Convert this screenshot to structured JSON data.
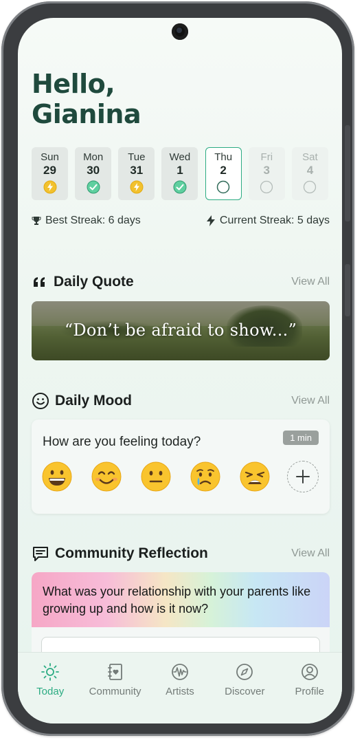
{
  "greeting": {
    "line1": "Hello,",
    "line2": "Gianina"
  },
  "week": [
    {
      "name": "Sun",
      "date": "29",
      "status": "lightning",
      "state": "past"
    },
    {
      "name": "Mon",
      "date": "30",
      "status": "check",
      "state": "past"
    },
    {
      "name": "Tue",
      "date": "31",
      "status": "lightning",
      "state": "past"
    },
    {
      "name": "Wed",
      "date": "1",
      "status": "check",
      "state": "past"
    },
    {
      "name": "Thu",
      "date": "2",
      "status": "empty",
      "state": "today"
    },
    {
      "name": "Fri",
      "date": "3",
      "status": "empty",
      "state": "future"
    },
    {
      "name": "Sat",
      "date": "4",
      "status": "empty",
      "state": "future"
    }
  ],
  "streaks": {
    "best": "Best Streak: 6 days",
    "current": "Current Streak: 5 days"
  },
  "daily_quote": {
    "title": "Daily Quote",
    "view_all": "View All",
    "text": "“Don’t be afraid to show...”"
  },
  "daily_mood": {
    "title": "Daily Mood",
    "view_all": "View All",
    "question": "How are you feeling today?",
    "time_badge": "1 min",
    "emojis": [
      "grinning-face",
      "smiling-face",
      "neutral-face",
      "crying-face",
      "weary-face"
    ]
  },
  "community": {
    "title": "Community Reflection",
    "view_all": "View All",
    "question": "What was your relationship with your parents like growing up and how is it now?"
  },
  "tabs": [
    {
      "label": "Today",
      "icon": "sun-icon",
      "active": true
    },
    {
      "label": "Community",
      "icon": "journal-heart-icon",
      "active": false
    },
    {
      "label": "Artists",
      "icon": "waveform-icon",
      "active": false
    },
    {
      "label": "Discover",
      "icon": "compass-icon",
      "active": false
    },
    {
      "label": "Profile",
      "icon": "user-icon",
      "active": false
    }
  ],
  "colors": {
    "accent": "#2bab82",
    "heading": "#1f4a3d",
    "bolt": "#f2c12e"
  }
}
